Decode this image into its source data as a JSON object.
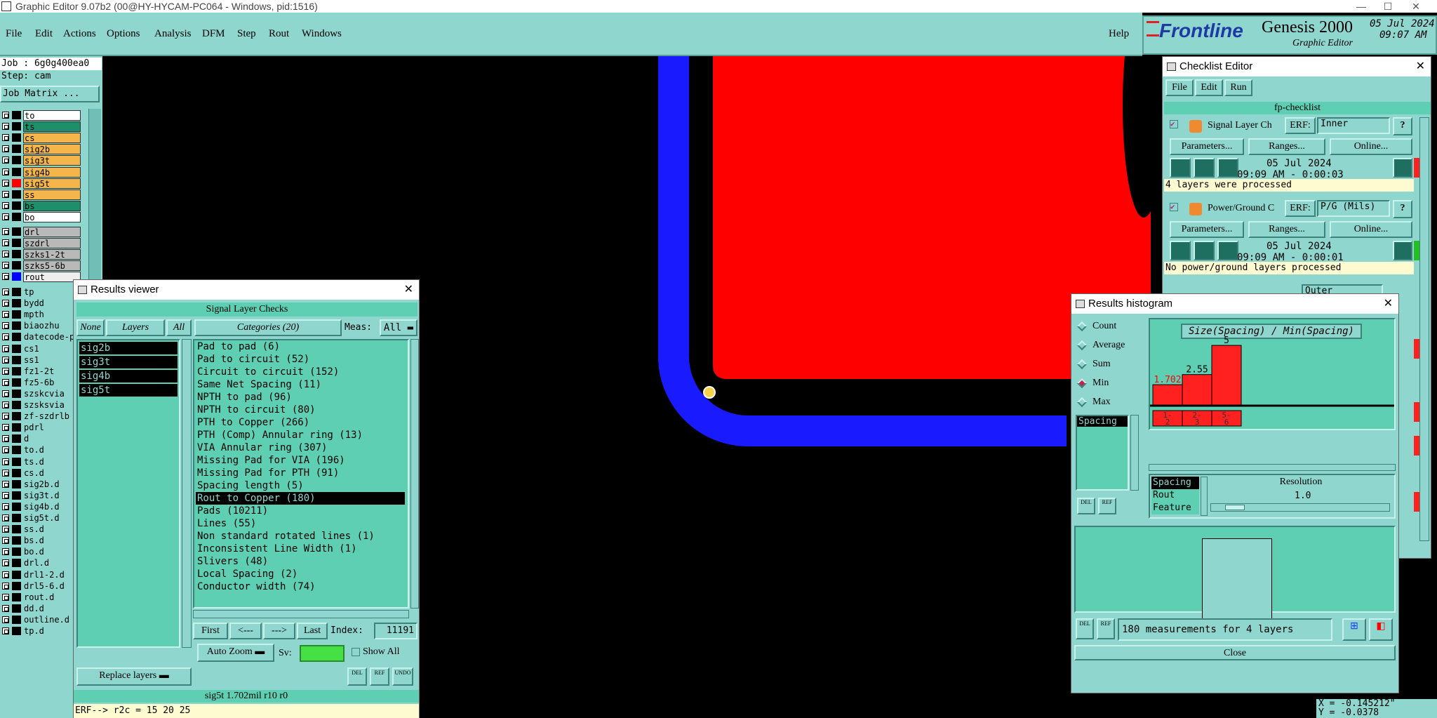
{
  "window": {
    "title": "Graphic Editor 9.07b2 (00@HY-HYCAM-PC064 - Windows, pid:1516)",
    "min": "—",
    "max": "☐",
    "close": "✕"
  },
  "menu": [
    "File",
    "Edit",
    "Actions",
    "Options",
    "Analysis",
    "DFM",
    "Step",
    "Rout",
    "Windows"
  ],
  "help": "Help",
  "brand": {
    "logo": "Frontline",
    "product": "Genesis 2000",
    "sub": "Graphic Editor",
    "date": "05 Jul 2024",
    "time": "09:07 AM"
  },
  "job": {
    "job": "Job : 6g0g400ea0",
    "step": "Step: cam",
    "matrix": "Job Matrix ..."
  },
  "layers": [
    {
      "name": "to",
      "color": "#ffffff",
      "box": "#000000"
    },
    {
      "name": "ts",
      "color": "#1f8f6b",
      "box": "#000000"
    },
    {
      "name": "cs",
      "color": "#f4b64a",
      "box": "#000000"
    },
    {
      "name": "sig2b",
      "color": "#f4b64a",
      "box": "#000000"
    },
    {
      "name": "sig3t",
      "color": "#f4b64a",
      "box": "#000000"
    },
    {
      "name": "sig4b",
      "color": "#f4b64a",
      "box": "#000000"
    },
    {
      "name": "sig5t",
      "color": "#f4b64a",
      "box": "#ff0000"
    },
    {
      "name": "ss",
      "color": "#f4b64a",
      "box": "#000000"
    },
    {
      "name": "bs",
      "color": "#1f8f6b",
      "box": "#000000"
    },
    {
      "name": "bo",
      "color": "#ffffff",
      "box": "#000000"
    }
  ],
  "layers2": [
    {
      "name": "drl",
      "color": "#b9b9b9",
      "box": "#000000"
    },
    {
      "name": "szdrl",
      "color": "#b9b9b9",
      "box": "#000000"
    },
    {
      "name": "szks1-2t",
      "color": "#b9b9b9",
      "box": "#000000"
    },
    {
      "name": "szks5-6b",
      "color": "#b9b9b9",
      "box": "#000000"
    },
    {
      "name": "rout",
      "color": "#eeeeee",
      "box": "#0000ff"
    }
  ],
  "layers3": [
    "tp",
    "bydd",
    "mpth",
    "biaozhu",
    "datecode-p",
    "cs1",
    "ss1",
    "fz1-2t",
    "fz5-6b",
    "szskcvia",
    "szsksvia",
    "zf-szdrlb",
    "pdrl",
    "d",
    "to.d",
    "ts.d",
    "cs.d",
    "sig2b.d",
    "sig3t.d",
    "sig4b.d",
    "sig5t.d",
    "ss.d",
    "bs.d",
    "bo.d",
    "drl.d",
    "drl1-2.d",
    "drl5-6.d",
    "rout.d",
    "dd.d",
    "outline.d",
    "tp.d"
  ],
  "results": {
    "title": "Results viewer",
    "header": "Signal Layer Checks",
    "none": "None",
    "layers": "Layers",
    "all": "All",
    "categories": "Categories (20)",
    "meas": "Meas:",
    "meas_val": "All",
    "layer_list": [
      "sig2b",
      "sig3t",
      "sig4b",
      "sig5t"
    ],
    "cats": [
      "Pad to pad (6)",
      "Pad to circuit (52)",
      "Circuit to circuit (152)",
      "Same Net Spacing (11)",
      "NPTH to pad (96)",
      "NPTH to circuit (80)",
      "PTH to Copper (266)",
      "PTH (Comp) Annular ring (13)",
      "VIA Annular ring (307)",
      "Missing Pad for VIA (196)",
      "Missing Pad for PTH (91)",
      "Spacing length (5)",
      "Rout to Copper (180)",
      "Pads (10211)",
      "Lines (55)",
      "Non standard rotated lines (1)",
      "Inconsistent Line Width (1)",
      "Slivers (48)",
      "Local Spacing (2)",
      "Conductor width (74)"
    ],
    "first": "First",
    "prev": "<---",
    "next": "--->",
    "last": "Last",
    "index_label": "Index:",
    "index": "11191",
    "autozoom": "Auto Zoom",
    "sv": "Sv:",
    "showall": "Show All",
    "replace": "Replace layers",
    "status": "sig5t 1.702mil  r10  r0",
    "erf": "ERF--> r2c = 15 20 25"
  },
  "checklist": {
    "title": "Checklist Editor",
    "menu": [
      "File",
      "Edit",
      "Run"
    ],
    "name": "fp-checklist",
    "items": [
      {
        "name": "Signal Layer Ch",
        "erf": "ERF:",
        "erf_val": "Inner",
        "params": "Parameters...",
        "ranges": "Ranges...",
        "online": "Online...",
        "date": "05 Jul 2024",
        "time": "09:09 AM - 0:00:03",
        "msg": "4 layers were processed",
        "flag": "#ff2020"
      },
      {
        "name": "Power/Ground C",
        "erf": "ERF:",
        "erf_val": "P/G (Mils)",
        "params": "Parameters...",
        "ranges": "Ranges...",
        "online": "Online...",
        "date": "05 Jul 2024",
        "time": "09:09 AM - 0:00:01",
        "msg": "No power/ground layers processed",
        "flag": "#22c022"
      }
    ],
    "third_erf": "Outer"
  },
  "histogram": {
    "title": "Results histogram",
    "modes": [
      "Count",
      "Average",
      "Sum",
      "Min",
      "Max"
    ],
    "selected": "Min",
    "chart_title": "Size(Spacing) / Min(Spacing)",
    "list": [
      "Spacing"
    ],
    "attrs": [
      "Spacing",
      "Rout",
      "Feature"
    ],
    "resolution": "Resolution",
    "res_val": "1.0",
    "status": "180 measurements for 4 layers",
    "close": "Close"
  },
  "chart_data": {
    "type": "bar",
    "title": "Size(Spacing) / Min(Spacing)",
    "categories": [
      "1-2",
      "2-3",
      "5-6"
    ],
    "values": [
      1.702,
      2.55,
      5
    ],
    "ylim": [
      0,
      5.3
    ]
  },
  "coords": {
    "x": "X = -0.145212\"",
    "y": "Y = -0.0378"
  }
}
